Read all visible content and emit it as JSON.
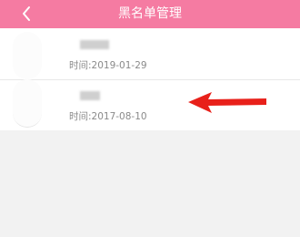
{
  "header": {
    "title": "黑名单管理",
    "back_icon": "chevron-left-icon",
    "background_color": "#f57ba2"
  },
  "blacklist": [
    {
      "time_label": "时间:",
      "time_value": "2019-01-29"
    },
    {
      "time_label": "时间:",
      "time_value": "2017-08-10"
    }
  ],
  "annotation": {
    "icon": "red-arrow-icon",
    "color": "#e8201a"
  }
}
